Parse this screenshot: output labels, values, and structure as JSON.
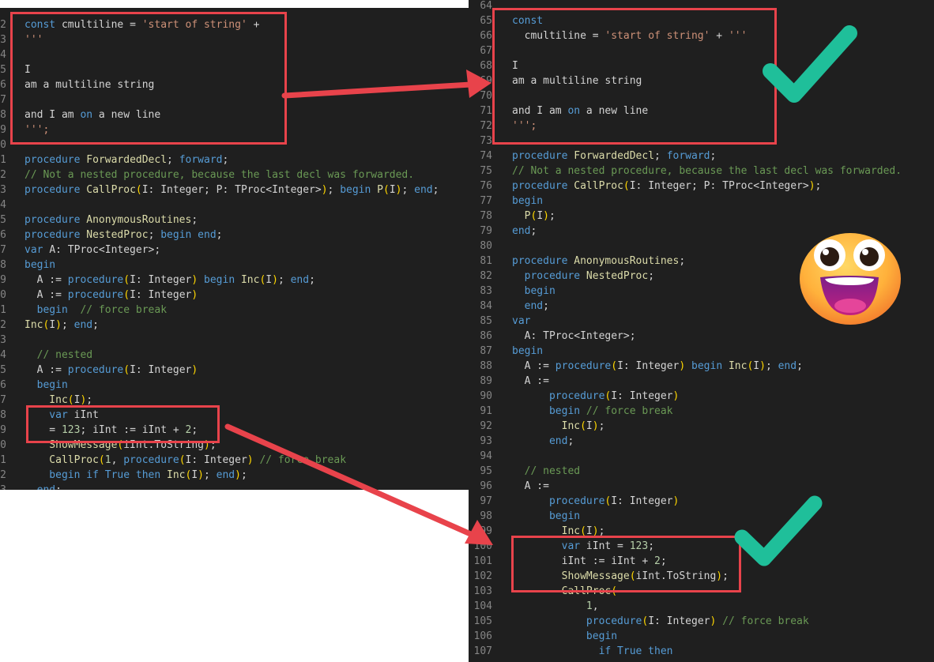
{
  "left_code": [
    {
      "n": "2",
      "segs": [
        [
          "kw",
          "const "
        ],
        [
          "ty",
          "cmultiline "
        ],
        [
          "ty",
          "= "
        ],
        [
          "str",
          "'start of string'"
        ],
        [
          "ty",
          " +"
        ]
      ]
    },
    {
      "n": "3",
      "segs": [
        [
          "str",
          "'''"
        ]
      ]
    },
    {
      "n": "4",
      "segs": []
    },
    {
      "n": "5",
      "segs": [
        [
          "ty",
          "I"
        ]
      ]
    },
    {
      "n": "6",
      "segs": [
        [
          "ty",
          "am a multiline string"
        ]
      ]
    },
    {
      "n": "7",
      "segs": []
    },
    {
      "n": "8",
      "segs": [
        [
          "ty",
          "and I am "
        ],
        [
          "kw",
          "on"
        ],
        [
          "ty",
          " a new line"
        ]
      ]
    },
    {
      "n": "9",
      "segs": [
        [
          "str",
          "''';"
        ]
      ]
    },
    {
      "n": "0",
      "segs": []
    },
    {
      "n": "1",
      "segs": [
        [
          "kw",
          "procedure "
        ],
        [
          "fn",
          "ForwardedDecl"
        ],
        [
          "ty",
          "; "
        ],
        [
          "kw",
          "forward"
        ],
        [
          "ty",
          ";"
        ]
      ]
    },
    {
      "n": "2",
      "segs": [
        [
          "com",
          "// Not a nested procedure, because the last decl was forwarded."
        ]
      ]
    },
    {
      "n": "3",
      "segs": [
        [
          "kw",
          "procedure "
        ],
        [
          "fn",
          "CallProc"
        ],
        [
          "br",
          "("
        ],
        [
          "ty",
          "I: Integer; P: TProc<Integer>"
        ],
        [
          "br",
          ")"
        ],
        [
          "ty",
          "; "
        ],
        [
          "kw",
          "begin "
        ],
        [
          "fn",
          "P"
        ],
        [
          "br",
          "("
        ],
        [
          "ty",
          "I"
        ],
        [
          "br",
          ")"
        ],
        [
          "ty",
          "; "
        ],
        [
          "kw",
          "end"
        ],
        [
          "ty",
          ";"
        ]
      ]
    },
    {
      "n": "4",
      "segs": []
    },
    {
      "n": "5",
      "segs": [
        [
          "kw",
          "procedure "
        ],
        [
          "fn",
          "AnonymousRoutines"
        ],
        [
          "ty",
          ";"
        ]
      ]
    },
    {
      "n": "6",
      "segs": [
        [
          "kw",
          "procedure "
        ],
        [
          "fn",
          "NestedProc"
        ],
        [
          "ty",
          "; "
        ],
        [
          "kw",
          "begin end"
        ],
        [
          "ty",
          ";"
        ]
      ]
    },
    {
      "n": "7",
      "segs": [
        [
          "kw",
          "var "
        ],
        [
          "ty",
          "A: TProc<Integer>;"
        ]
      ]
    },
    {
      "n": "8",
      "segs": [
        [
          "kw",
          "begin"
        ]
      ]
    },
    {
      "n": "9",
      "segs": [
        [
          "ty",
          "  A := "
        ],
        [
          "kw",
          "procedure"
        ],
        [
          "br",
          "("
        ],
        [
          "ty",
          "I: Integer"
        ],
        [
          "br",
          ")"
        ],
        [
          "kw",
          " begin "
        ],
        [
          "fn",
          "Inc"
        ],
        [
          "br",
          "("
        ],
        [
          "ty",
          "I"
        ],
        [
          "br",
          ")"
        ],
        [
          "ty",
          "; "
        ],
        [
          "kw",
          "end"
        ],
        [
          "ty",
          ";"
        ]
      ]
    },
    {
      "n": "0",
      "segs": [
        [
          "ty",
          "  A := "
        ],
        [
          "kw",
          "procedure"
        ],
        [
          "br",
          "("
        ],
        [
          "ty",
          "I: Integer"
        ],
        [
          "br",
          ")"
        ]
      ]
    },
    {
      "n": "1",
      "segs": [
        [
          "kw",
          "  begin  "
        ],
        [
          "com",
          "// force break"
        ]
      ]
    },
    {
      "n": "2",
      "segs": [
        [
          "fn",
          "Inc"
        ],
        [
          "br",
          "("
        ],
        [
          "ty",
          "I"
        ],
        [
          "br",
          ")"
        ],
        [
          "ty",
          "; "
        ],
        [
          "kw",
          "end"
        ],
        [
          "ty",
          ";"
        ]
      ]
    },
    {
      "n": "3",
      "segs": []
    },
    {
      "n": "4",
      "segs": [
        [
          "com",
          "  // nested"
        ]
      ]
    },
    {
      "n": "5",
      "segs": [
        [
          "ty",
          "  A := "
        ],
        [
          "kw",
          "procedure"
        ],
        [
          "br",
          "("
        ],
        [
          "ty",
          "I: Integer"
        ],
        [
          "br",
          ")"
        ]
      ]
    },
    {
      "n": "6",
      "segs": [
        [
          "kw",
          "  begin"
        ]
      ]
    },
    {
      "n": "7",
      "segs": [
        [
          "fn",
          "    Inc"
        ],
        [
          "br",
          "("
        ],
        [
          "ty",
          "I"
        ],
        [
          "br",
          ")"
        ],
        [
          "ty",
          ";"
        ]
      ]
    },
    {
      "n": "8",
      "segs": [
        [
          "kw",
          "    var "
        ],
        [
          "ty",
          "iInt"
        ]
      ]
    },
    {
      "n": "9",
      "segs": [
        [
          "ty",
          "    = "
        ],
        [
          "num",
          "123"
        ],
        [
          "ty",
          "; iInt := iInt + "
        ],
        [
          "num",
          "2"
        ],
        [
          "ty",
          ";"
        ]
      ]
    },
    {
      "n": "0",
      "segs": [
        [
          "fn",
          "    ShowMessage"
        ],
        [
          "br",
          "("
        ],
        [
          "ty",
          "iInt.ToString"
        ],
        [
          "br",
          ")"
        ],
        [
          "ty",
          ";"
        ]
      ]
    },
    {
      "n": "1",
      "segs": [
        [
          "fn",
          "    CallProc"
        ],
        [
          "br",
          "("
        ],
        [
          "num",
          "1"
        ],
        [
          "ty",
          ", "
        ],
        [
          "kw",
          "procedure"
        ],
        [
          "br",
          "("
        ],
        [
          "ty",
          "I: Integer"
        ],
        [
          "br",
          ")"
        ],
        [
          "com",
          " // force break"
        ]
      ]
    },
    {
      "n": "2",
      "segs": [
        [
          "kw",
          "    begin if True then "
        ],
        [
          "fn",
          "Inc"
        ],
        [
          "br",
          "("
        ],
        [
          "ty",
          "I"
        ],
        [
          "br",
          ")"
        ],
        [
          "ty",
          "; "
        ],
        [
          "kw",
          "end"
        ],
        [
          "br",
          ")"
        ],
        [
          "ty",
          ";"
        ]
      ]
    },
    {
      "n": "3",
      "segs": [
        [
          "kw",
          "  end"
        ],
        [
          "ty",
          ";"
        ]
      ]
    }
  ],
  "right_code": [
    {
      "n": "64",
      "segs": []
    },
    {
      "n": "65",
      "segs": [
        [
          "kw",
          "const"
        ]
      ]
    },
    {
      "n": "66",
      "segs": [
        [
          "ty",
          "  cmultiline = "
        ],
        [
          "str",
          "'start of string'"
        ],
        [
          "ty",
          " + "
        ],
        [
          "str",
          "'''"
        ]
      ]
    },
    {
      "n": "67",
      "segs": []
    },
    {
      "n": "68",
      "segs": [
        [
          "ty",
          "I"
        ]
      ]
    },
    {
      "n": "69",
      "segs": [
        [
          "ty",
          "am a multiline string"
        ]
      ]
    },
    {
      "n": "70",
      "segs": []
    },
    {
      "n": "71",
      "segs": [
        [
          "ty",
          "and I am "
        ],
        [
          "kw",
          "on"
        ],
        [
          "ty",
          " a new line"
        ]
      ]
    },
    {
      "n": "72",
      "segs": [
        [
          "str",
          "''';"
        ]
      ]
    },
    {
      "n": "73",
      "segs": []
    },
    {
      "n": "74",
      "segs": [
        [
          "kw",
          "procedure "
        ],
        [
          "fn",
          "ForwardedDecl"
        ],
        [
          "ty",
          "; "
        ],
        [
          "kw",
          "forward"
        ],
        [
          "ty",
          ";"
        ]
      ]
    },
    {
      "n": "75",
      "segs": [
        [
          "com",
          "// Not a nested procedure, because the last decl was forwarded."
        ]
      ]
    },
    {
      "n": "76",
      "segs": [
        [
          "kw",
          "procedure "
        ],
        [
          "fn",
          "CallProc"
        ],
        [
          "br",
          "("
        ],
        [
          "ty",
          "I: Integer; P: TProc<Integer>"
        ],
        [
          "br",
          ")"
        ],
        [
          "ty",
          ";"
        ]
      ]
    },
    {
      "n": "77",
      "segs": [
        [
          "kw",
          "begin"
        ]
      ]
    },
    {
      "n": "78",
      "segs": [
        [
          "fn",
          "  P"
        ],
        [
          "br",
          "("
        ],
        [
          "ty",
          "I"
        ],
        [
          "br",
          ")"
        ],
        [
          "ty",
          ";"
        ]
      ]
    },
    {
      "n": "79",
      "segs": [
        [
          "kw",
          "end"
        ],
        [
          "ty",
          ";"
        ]
      ]
    },
    {
      "n": "80",
      "segs": []
    },
    {
      "n": "81",
      "segs": [
        [
          "kw",
          "procedure "
        ],
        [
          "fn",
          "AnonymousRoutines"
        ],
        [
          "ty",
          ";"
        ]
      ]
    },
    {
      "n": "82",
      "segs": [
        [
          "kw",
          "  procedure "
        ],
        [
          "fn",
          "NestedProc"
        ],
        [
          "ty",
          ";"
        ]
      ]
    },
    {
      "n": "83",
      "segs": [
        [
          "kw",
          "  begin"
        ]
      ]
    },
    {
      "n": "84",
      "segs": [
        [
          "kw",
          "  end"
        ],
        [
          "ty",
          ";"
        ]
      ]
    },
    {
      "n": "85",
      "segs": [
        [
          "kw",
          "var"
        ]
      ]
    },
    {
      "n": "86",
      "segs": [
        [
          "ty",
          "  A: TProc<Integer>;"
        ]
      ]
    },
    {
      "n": "87",
      "segs": [
        [
          "kw",
          "begin"
        ]
      ]
    },
    {
      "n": "88",
      "segs": [
        [
          "ty",
          "  A := "
        ],
        [
          "kw",
          "procedure"
        ],
        [
          "br",
          "("
        ],
        [
          "ty",
          "I: Integer"
        ],
        [
          "br",
          ")"
        ],
        [
          "kw",
          " begin "
        ],
        [
          "fn",
          "Inc"
        ],
        [
          "br",
          "("
        ],
        [
          "ty",
          "I"
        ],
        [
          "br",
          ")"
        ],
        [
          "ty",
          "; "
        ],
        [
          "kw",
          "end"
        ],
        [
          "ty",
          ";"
        ]
      ]
    },
    {
      "n": "89",
      "segs": [
        [
          "ty",
          "  A :="
        ]
      ]
    },
    {
      "n": "90",
      "segs": [
        [
          "kw",
          "      procedure"
        ],
        [
          "br",
          "("
        ],
        [
          "ty",
          "I: Integer"
        ],
        [
          "br",
          ")"
        ]
      ]
    },
    {
      "n": "91",
      "segs": [
        [
          "kw",
          "      begin "
        ],
        [
          "com",
          "// force break"
        ]
      ]
    },
    {
      "n": "92",
      "segs": [
        [
          "fn",
          "        Inc"
        ],
        [
          "br",
          "("
        ],
        [
          "ty",
          "I"
        ],
        [
          "br",
          ")"
        ],
        [
          "ty",
          ";"
        ]
      ]
    },
    {
      "n": "93",
      "segs": [
        [
          "kw",
          "      end"
        ],
        [
          "ty",
          ";"
        ]
      ]
    },
    {
      "n": "94",
      "segs": []
    },
    {
      "n": "95",
      "segs": [
        [
          "com",
          "  // nested"
        ]
      ]
    },
    {
      "n": "96",
      "segs": [
        [
          "ty",
          "  A :="
        ]
      ]
    },
    {
      "n": "97",
      "segs": [
        [
          "kw",
          "      procedure"
        ],
        [
          "br",
          "("
        ],
        [
          "ty",
          "I: Integer"
        ],
        [
          "br",
          ")"
        ]
      ]
    },
    {
      "n": "98",
      "segs": [
        [
          "kw",
          "      begin"
        ]
      ]
    },
    {
      "n": "99",
      "segs": [
        [
          "fn",
          "        Inc"
        ],
        [
          "br",
          "("
        ],
        [
          "ty",
          "I"
        ],
        [
          "br",
          ")"
        ],
        [
          "ty",
          ";"
        ]
      ]
    },
    {
      "n": "100",
      "segs": [
        [
          "kw",
          "        var "
        ],
        [
          "ty",
          "iInt = "
        ],
        [
          "num",
          "123"
        ],
        [
          "ty",
          ";"
        ]
      ]
    },
    {
      "n": "101",
      "segs": [
        [
          "ty",
          "        iInt := iInt + "
        ],
        [
          "num",
          "2"
        ],
        [
          "ty",
          ";"
        ]
      ]
    },
    {
      "n": "102",
      "segs": [
        [
          "fn",
          "        ShowMessage"
        ],
        [
          "br",
          "("
        ],
        [
          "ty",
          "iInt.ToString"
        ],
        [
          "br",
          ")"
        ],
        [
          "ty",
          ";"
        ]
      ]
    },
    {
      "n": "103",
      "segs": [
        [
          "fn",
          "        CallProc"
        ],
        [
          "br",
          "("
        ]
      ]
    },
    {
      "n": "104",
      "segs": [
        [
          "num",
          "            1"
        ],
        [
          "ty",
          ","
        ]
      ]
    },
    {
      "n": "105",
      "segs": [
        [
          "kw",
          "            procedure"
        ],
        [
          "br",
          "("
        ],
        [
          "ty",
          "I: Integer"
        ],
        [
          "br",
          ")"
        ],
        [
          "com",
          " // force break"
        ]
      ]
    },
    {
      "n": "106",
      "segs": [
        [
          "kw",
          "            begin"
        ]
      ]
    },
    {
      "n": "107",
      "segs": [
        [
          "kw",
          "              if True then"
        ]
      ]
    }
  ],
  "colors": {
    "editor_bg": "#1f1f1f",
    "highlight_border": "#e8434b",
    "arrow": "#e8434b",
    "check": "#1fbf9a"
  },
  "icons": {
    "checkmark": "checkmark-icon",
    "emoji": "grinning-face-emoji"
  }
}
